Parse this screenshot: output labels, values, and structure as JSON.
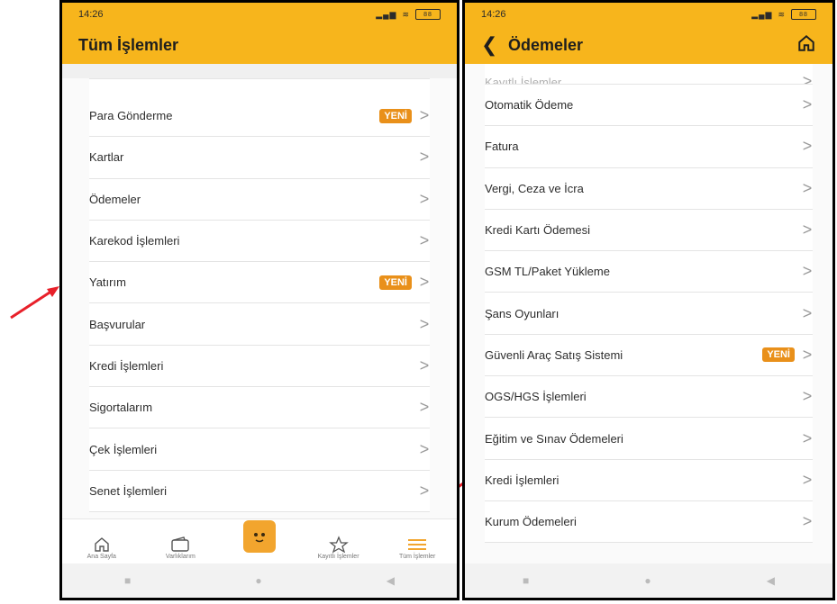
{
  "left": {
    "status_time": "14:26",
    "battery": "88",
    "title": "Tüm İşlemler",
    "badge": "YENİ",
    "items": [
      {
        "label": "Para Gönderme",
        "badge": true
      },
      {
        "label": "Kartlar",
        "badge": false
      },
      {
        "label": "Ödemeler",
        "badge": false
      },
      {
        "label": "Karekod İşlemleri",
        "badge": false
      },
      {
        "label": "Yatırım",
        "badge": true
      },
      {
        "label": "Başvurular",
        "badge": false
      },
      {
        "label": "Kredi İşlemleri",
        "badge": false
      },
      {
        "label": "Sigortalarım",
        "badge": false
      },
      {
        "label": "Çek İşlemleri",
        "badge": false
      },
      {
        "label": "Senet İşlemleri",
        "badge": false
      }
    ],
    "tabs": [
      "Ana Sayfa",
      "Varlıklarım",
      "",
      "Kayıtlı İşlemler",
      "Tüm İşlemler"
    ]
  },
  "right": {
    "status_time": "14:26",
    "battery": "88",
    "title": "Ödemeler",
    "badge": "YENİ",
    "partial_item": "Kayıtlı İşlemler",
    "items": [
      {
        "label": "Otomatik Ödeme",
        "badge": false
      },
      {
        "label": "Fatura",
        "badge": false
      },
      {
        "label": "Vergi, Ceza ve İcra",
        "badge": false
      },
      {
        "label": "Kredi Kartı Ödemesi",
        "badge": false
      },
      {
        "label": "GSM TL/Paket Yükleme",
        "badge": false
      },
      {
        "label": "Şans Oyunları",
        "badge": false
      },
      {
        "label": "Güvenli Araç Satış Sistemi",
        "badge": true
      },
      {
        "label": "OGS/HGS İşlemleri",
        "badge": false
      },
      {
        "label": "Eğitim ve Sınav Ödemeleri",
        "badge": false
      },
      {
        "label": "Kredi İşlemleri",
        "badge": false
      },
      {
        "label": "Kurum Ödemeleri",
        "badge": false
      }
    ]
  },
  "colors": {
    "accent": "#f7b51c",
    "badge": "#e9901a",
    "arrow": "#e8202a"
  }
}
